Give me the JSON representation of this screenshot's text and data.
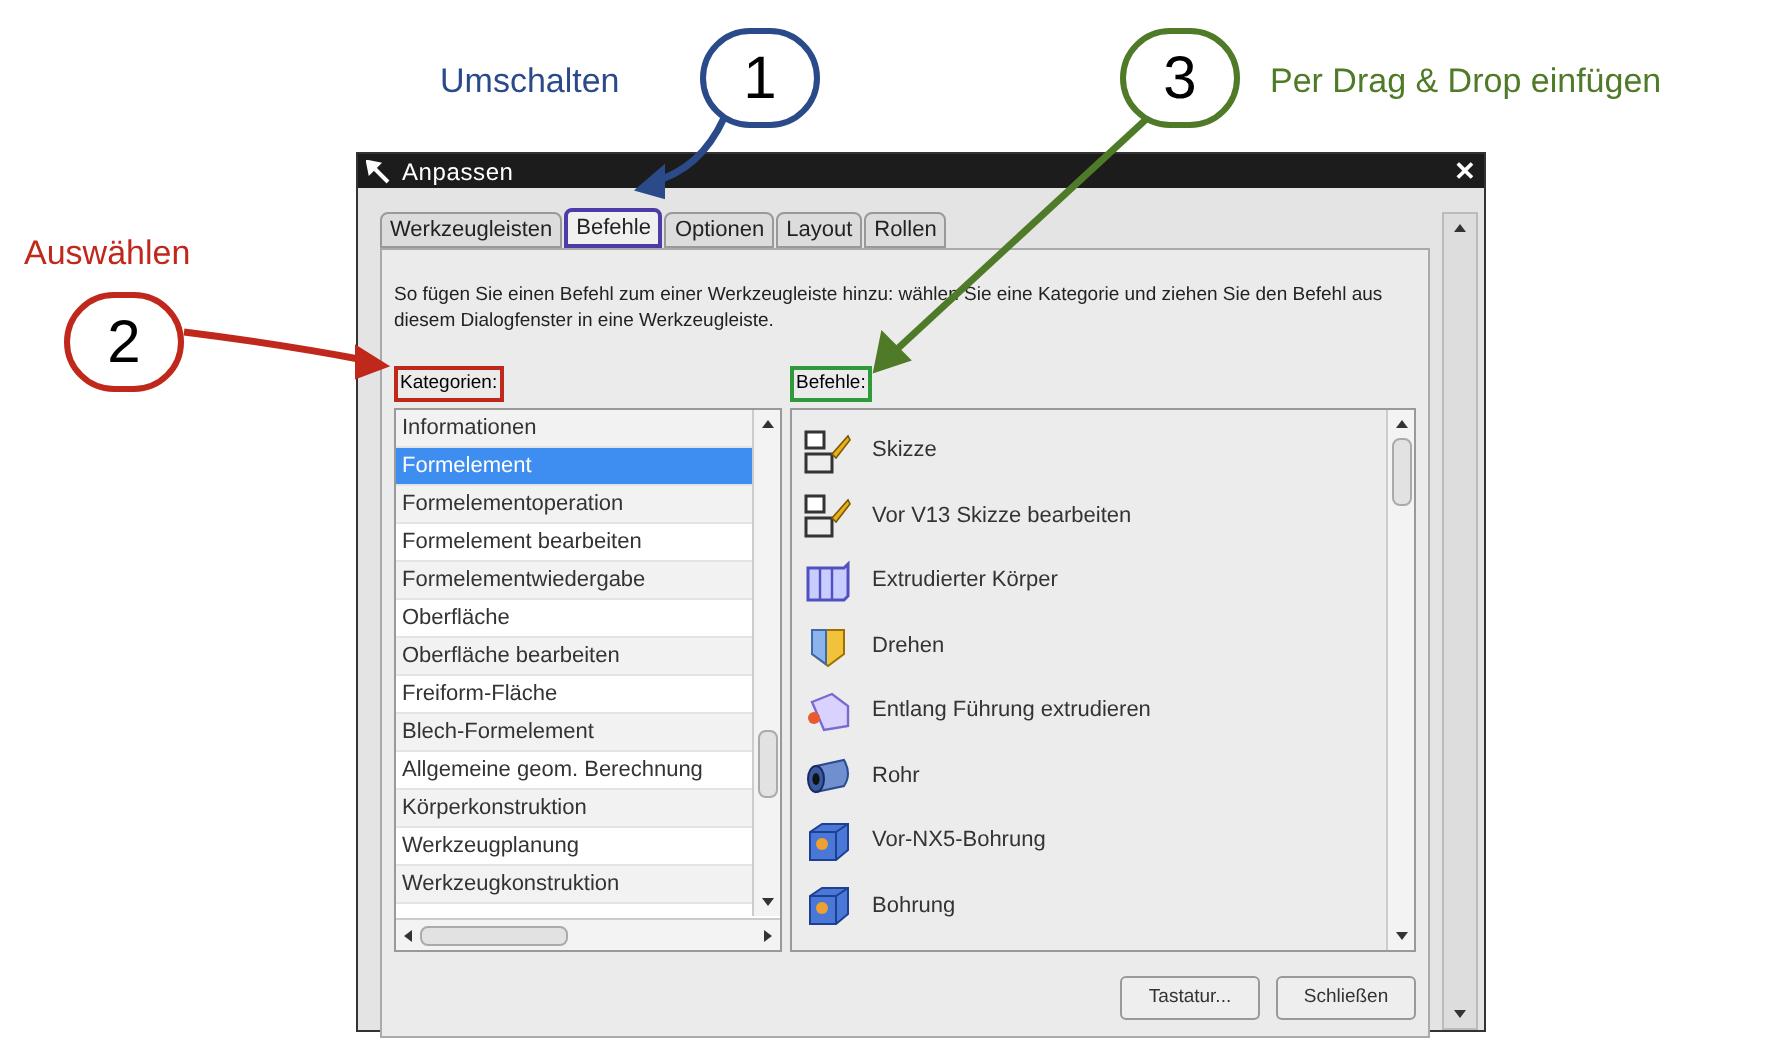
{
  "callouts": [
    {
      "number": "1",
      "text": "Umschalten",
      "color": "#2b4a8a"
    },
    {
      "number": "2",
      "text": "Auswählen",
      "color": "#c0281c"
    },
    {
      "number": "3",
      "text": "Per Drag & Drop einfügen",
      "color": "#4f7a28"
    }
  ],
  "window": {
    "title": "Anpassen",
    "close": "✕"
  },
  "tabs": [
    {
      "label": "Werkzeugleisten",
      "selected": false
    },
    {
      "label": "Befehle",
      "selected": true,
      "color": "#4b3ca8"
    },
    {
      "label": "Optionen",
      "selected": false
    },
    {
      "label": "Layout",
      "selected": false
    },
    {
      "label": "Rollen",
      "selected": false
    }
  ],
  "description": "So fügen Sie einen Befehl zum einer Werkzeugleiste hinzu: wählen Sie eine Kategorie und ziehen Sie den Befehl aus diesem Dialogfenster in eine Werkzeugleiste.",
  "categories": {
    "label": "Kategorien:",
    "color": "#c0281c",
    "items": [
      {
        "label": "Informationen",
        "selected": false
      },
      {
        "label": "Formelement",
        "selected": true
      },
      {
        "label": "Formelementoperation",
        "selected": false
      },
      {
        "label": "Formelement bearbeiten",
        "selected": false
      },
      {
        "label": "Formelementwiedergabe",
        "selected": false
      },
      {
        "label": "Oberfläche",
        "selected": false
      },
      {
        "label": "Oberfläche bearbeiten",
        "selected": false
      },
      {
        "label": "Freiform-Fläche",
        "selected": false
      },
      {
        "label": "Blech-Formelement",
        "selected": false
      },
      {
        "label": "Allgemeine geom. Berechnung",
        "selected": false
      },
      {
        "label": "Körperkonstruktion",
        "selected": false
      },
      {
        "label": "Werkzeugplanung",
        "selected": false
      },
      {
        "label": "Werkzeugkonstruktion",
        "selected": false
      }
    ]
  },
  "commands": {
    "label": "Befehle:",
    "color": "#2f9a3a",
    "items": [
      {
        "label": "Skizze",
        "kind": "sketch"
      },
      {
        "label": "Vor V13 Skizze bearbeiten",
        "kind": "sketch"
      },
      {
        "label": "Extrudierter Körper",
        "kind": "extrude"
      },
      {
        "label": "Drehen",
        "kind": "revolve"
      },
      {
        "label": "Entlang Führung extrudieren",
        "kind": "sweep"
      },
      {
        "label": "Rohr",
        "kind": "tube"
      },
      {
        "label": "Vor-NX5-Bohrung",
        "kind": "hole"
      },
      {
        "label": "Bohrung",
        "kind": "hole"
      }
    ]
  },
  "buttons": [
    "Tastatur...",
    "Schließen"
  ]
}
